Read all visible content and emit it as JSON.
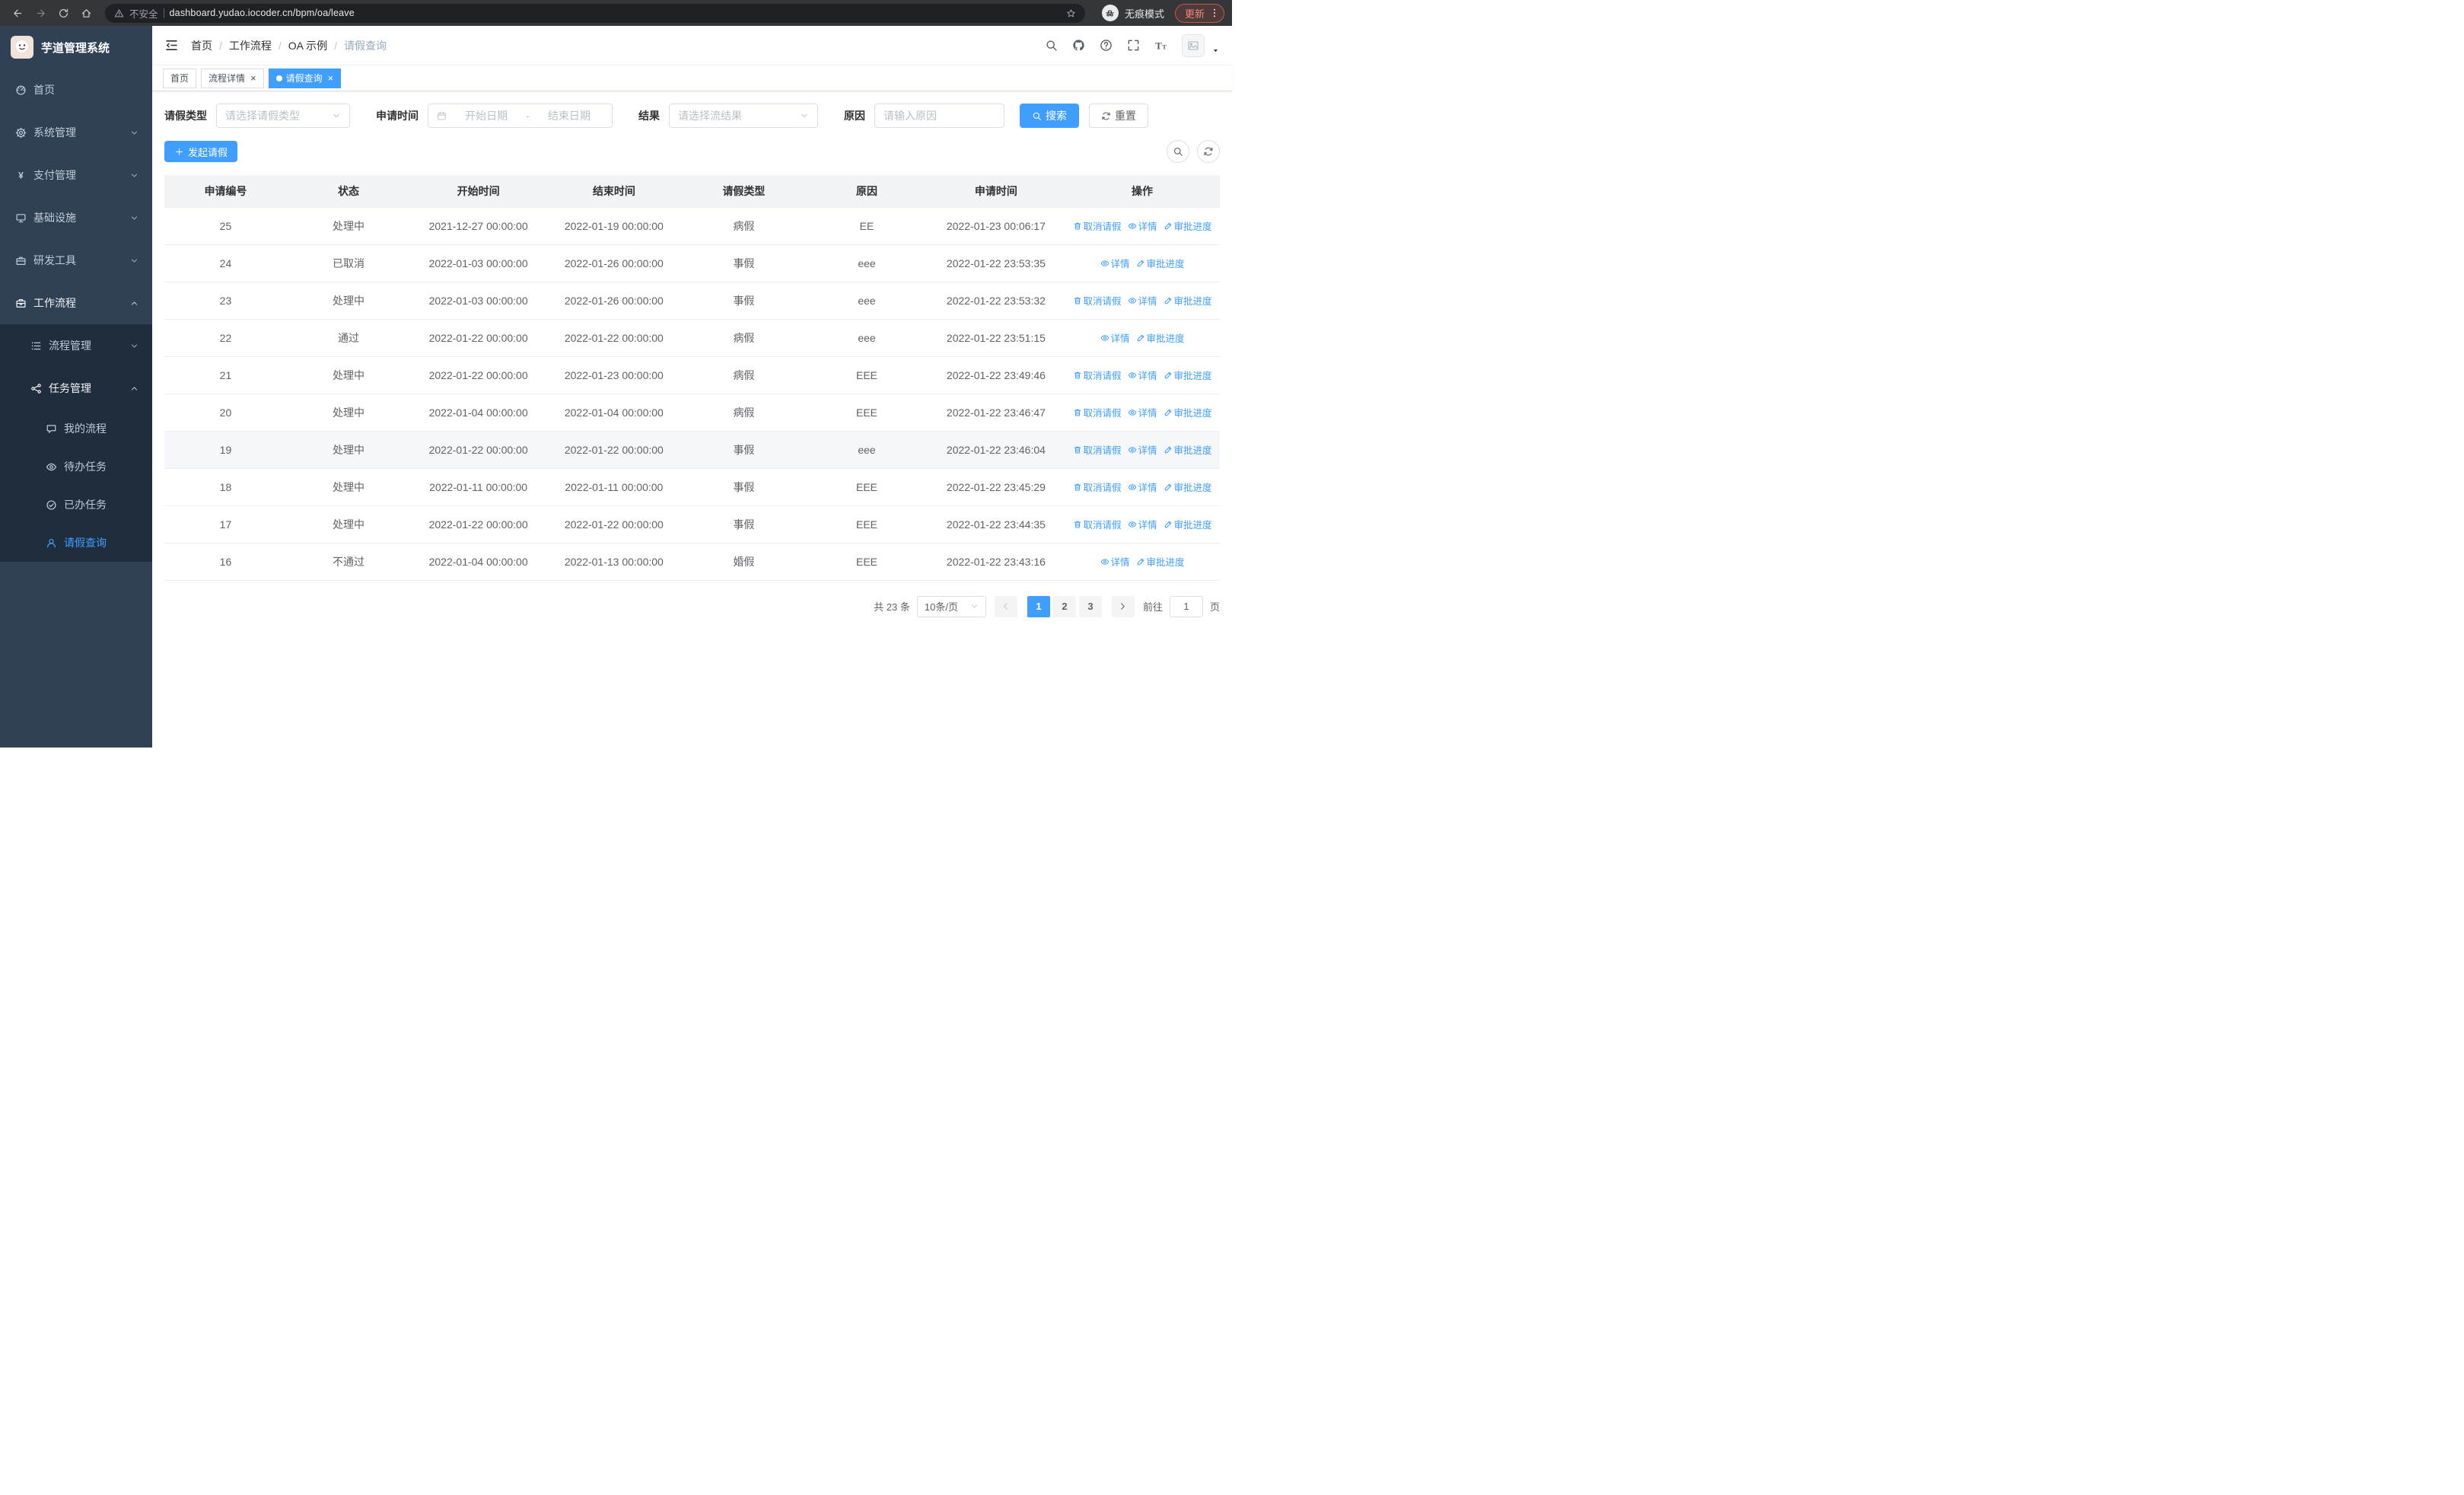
{
  "browser": {
    "security_label": "不安全",
    "url": "dashboard.yudao.iocoder.cn/bpm/oa/leave",
    "incognito_label": "无痕模式",
    "update_label": "更新"
  },
  "sidebar": {
    "title": "芋道管理系统",
    "items": [
      {
        "key": "home",
        "label": "首页",
        "icon": "dashboard-icon",
        "level": 1
      },
      {
        "key": "system-management",
        "label": "系统管理",
        "icon": "gear-icon",
        "level": 1,
        "chevron": "down"
      },
      {
        "key": "payment-management",
        "label": "支付管理",
        "icon": "yen-icon",
        "level": 1,
        "chevron": "down"
      },
      {
        "key": "infrastructure",
        "label": "基础设施",
        "icon": "infra-icon",
        "level": 1,
        "chevron": "down"
      },
      {
        "key": "dev-tools",
        "label": "研发工具",
        "icon": "tools-icon",
        "level": 1,
        "chevron": "down"
      },
      {
        "key": "workflow",
        "label": "工作流程",
        "icon": "workflow-icon",
        "level": 1,
        "chevron": "up",
        "open": true
      },
      {
        "key": "process-management",
        "label": "流程管理",
        "icon": "process-icon",
        "level": 2,
        "chevron": "down"
      },
      {
        "key": "task-management",
        "label": "任务管理",
        "icon": "task-icon",
        "level": 2,
        "chevron": "up",
        "open": true
      },
      {
        "key": "my-process",
        "label": "我的流程",
        "icon": "chat-icon",
        "level": 3
      },
      {
        "key": "todo-tasks",
        "label": "待办任务",
        "icon": "eye-icon",
        "level": 3
      },
      {
        "key": "done-tasks",
        "label": "已办任务",
        "icon": "done-icon",
        "level": 3
      },
      {
        "key": "leave-query",
        "label": "请假查询",
        "icon": "user-icon",
        "level": 3,
        "active": true
      }
    ]
  },
  "breadcrumb": {
    "items": [
      "首页",
      "工作流程",
      "OA 示例",
      "请假查询"
    ]
  },
  "tabs": {
    "items": [
      {
        "label": "首页",
        "closable": false,
        "active": false
      },
      {
        "label": "流程详情",
        "closable": true,
        "active": false
      },
      {
        "label": "请假查询",
        "closable": true,
        "active": true
      }
    ]
  },
  "filter": {
    "type_label": "请假类型",
    "type_placeholder": "请选择请假类型",
    "time_label": "申请时间",
    "start_placeholder": "开始日期",
    "range_separator": "-",
    "end_placeholder": "结束日期",
    "result_label": "结果",
    "result_placeholder": "请选择流结果",
    "reason_label": "原因",
    "reason_placeholder": "请输入原因",
    "search_label": "搜索",
    "reset_label": "重置"
  },
  "toolbar": {
    "create_label": "发起请假"
  },
  "table": {
    "columns": [
      "申请编号",
      "状态",
      "开始时间",
      "结束时间",
      "请假类型",
      "原因",
      "申请时间",
      "操作"
    ],
    "action_labels": {
      "cancel": "取消请假",
      "detail": "详情",
      "progress": "审批进度"
    },
    "rows": [
      {
        "id": "25",
        "status": "处理中",
        "start": "2021-12-27 00:00:00",
        "end": "2022-01-19 00:00:00",
        "type": "病假",
        "reason": "EE",
        "applied": "2022-01-23 00:06:17",
        "actions": [
          "cancel",
          "detail",
          "progress"
        ],
        "highlight": false
      },
      {
        "id": "24",
        "status": "已取消",
        "start": "2022-01-03 00:00:00",
        "end": "2022-01-26 00:00:00",
        "type": "事假",
        "reason": "eee",
        "applied": "2022-01-22 23:53:35",
        "actions": [
          "detail",
          "progress"
        ],
        "highlight": false
      },
      {
        "id": "23",
        "status": "处理中",
        "start": "2022-01-03 00:00:00",
        "end": "2022-01-26 00:00:00",
        "type": "事假",
        "reason": "eee",
        "applied": "2022-01-22 23:53:32",
        "actions": [
          "cancel",
          "detail",
          "progress"
        ],
        "highlight": false
      },
      {
        "id": "22",
        "status": "通过",
        "start": "2022-01-22 00:00:00",
        "end": "2022-01-22 00:00:00",
        "type": "病假",
        "reason": "eee",
        "applied": "2022-01-22 23:51:15",
        "actions": [
          "detail",
          "progress"
        ],
        "highlight": false
      },
      {
        "id": "21",
        "status": "处理中",
        "start": "2022-01-22 00:00:00",
        "end": "2022-01-23 00:00:00",
        "type": "病假",
        "reason": "EEE",
        "applied": "2022-01-22 23:49:46",
        "actions": [
          "cancel",
          "detail",
          "progress"
        ],
        "highlight": false
      },
      {
        "id": "20",
        "status": "处理中",
        "start": "2022-01-04 00:00:00",
        "end": "2022-01-04 00:00:00",
        "type": "病假",
        "reason": "EEE",
        "applied": "2022-01-22 23:46:47",
        "actions": [
          "cancel",
          "detail",
          "progress"
        ],
        "highlight": false
      },
      {
        "id": "19",
        "status": "处理中",
        "start": "2022-01-22 00:00:00",
        "end": "2022-01-22 00:00:00",
        "type": "事假",
        "reason": "eee",
        "applied": "2022-01-22 23:46:04",
        "actions": [
          "cancel",
          "detail",
          "progress"
        ],
        "highlight": true
      },
      {
        "id": "18",
        "status": "处理中",
        "start": "2022-01-11 00:00:00",
        "end": "2022-01-11 00:00:00",
        "type": "事假",
        "reason": "EEE",
        "applied": "2022-01-22 23:45:29",
        "actions": [
          "cancel",
          "detail",
          "progress"
        ],
        "highlight": false
      },
      {
        "id": "17",
        "status": "处理中",
        "start": "2022-01-22 00:00:00",
        "end": "2022-01-22 00:00:00",
        "type": "事假",
        "reason": "EEE",
        "applied": "2022-01-22 23:44:35",
        "actions": [
          "cancel",
          "detail",
          "progress"
        ],
        "highlight": false
      },
      {
        "id": "16",
        "status": "不通过",
        "start": "2022-01-04 00:00:00",
        "end": "2022-01-13 00:00:00",
        "type": "婚假",
        "reason": "EEE",
        "applied": "2022-01-22 23:43:16",
        "actions": [
          "detail",
          "progress"
        ],
        "highlight": false
      }
    ]
  },
  "pagination": {
    "total_label": "共 23 条",
    "page_size": "10条/页",
    "pages": [
      "1",
      "2",
      "3"
    ],
    "active_page": "1",
    "goto_label": "前往",
    "goto_value": "1",
    "goto_suffix": "页"
  },
  "colors": {
    "accent": "#409EFF",
    "sidebar_bg": "#304156",
    "submenu_bg": "#1f2d3d"
  }
}
